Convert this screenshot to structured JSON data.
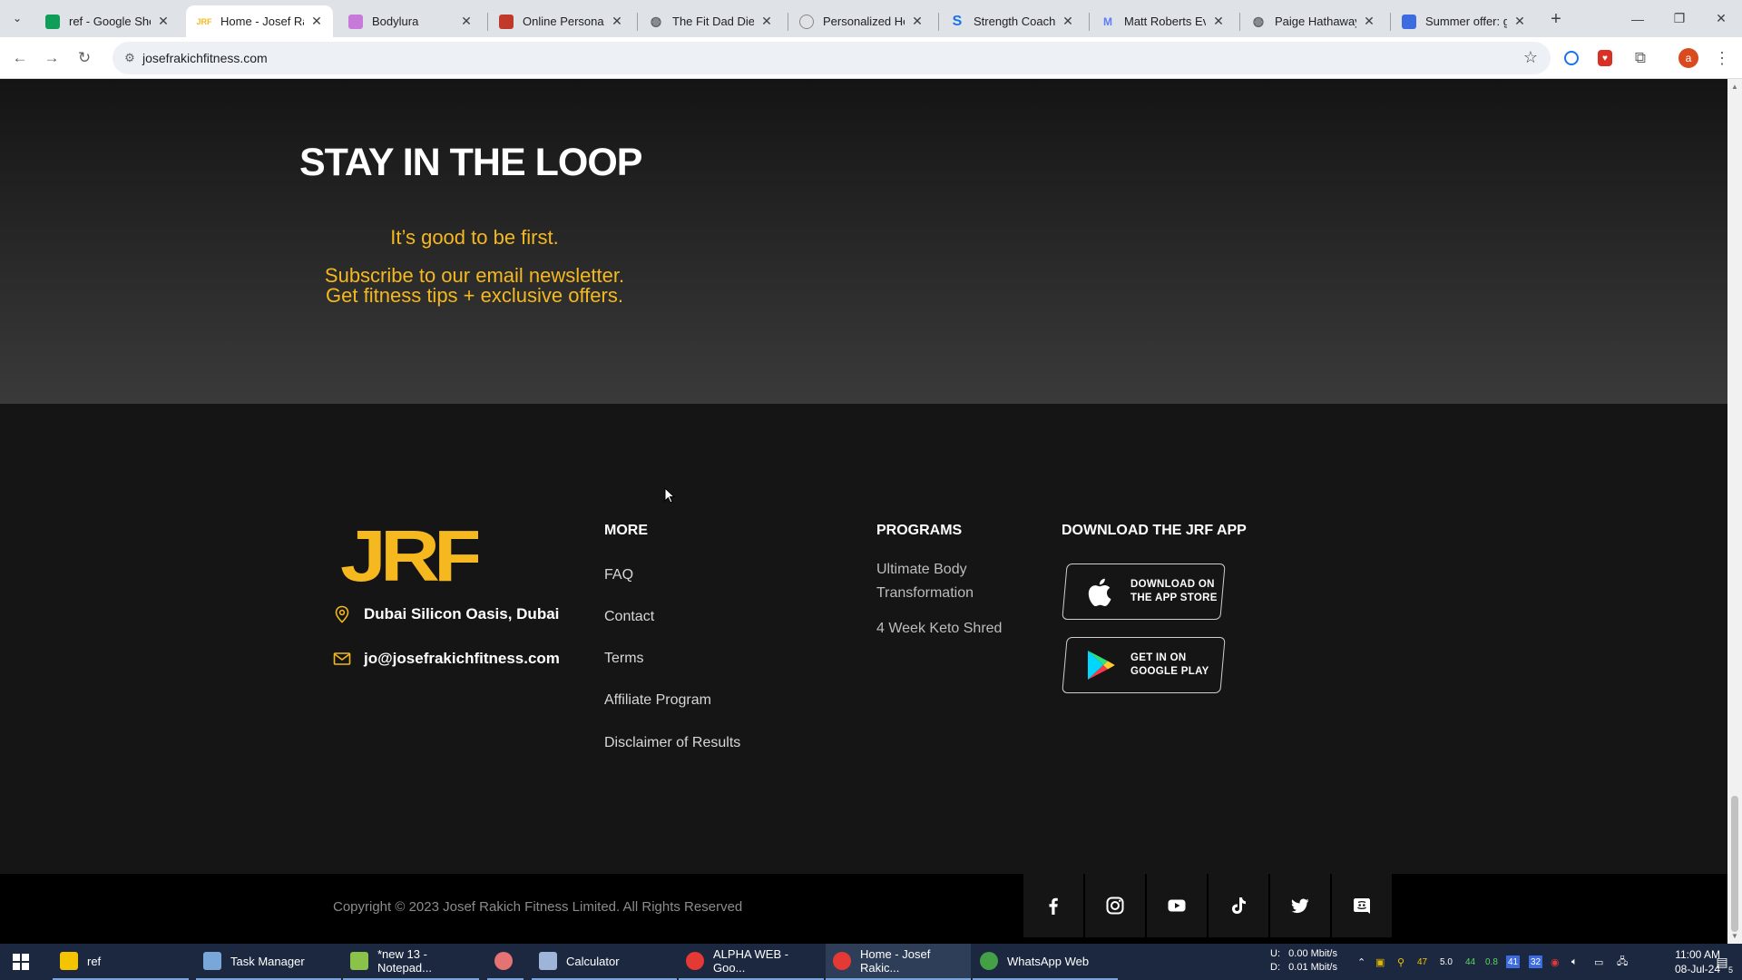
{
  "browser": {
    "tabs": [
      {
        "title": "ref - Google Shee",
        "favicon": "sheets-icon",
        "color": "#0f9d58"
      },
      {
        "title": "Home - Josef Rak",
        "favicon": "jrf-icon",
        "color": "#f5b81e",
        "active": true
      },
      {
        "title": "Bodylura",
        "favicon": "bodylura-icon",
        "color": "#c77ad9"
      },
      {
        "title": "Online Personal Tr",
        "favicon": "trainer-icon",
        "color": "#c0392b"
      },
      {
        "title": "The Fit Dad Diet: /",
        "favicon": "globe-icon",
        "color": "#5f6368"
      },
      {
        "title": "Personalized Heal",
        "favicon": "health-icon",
        "color": "#888888"
      },
      {
        "title": "Strength Coach G",
        "favicon": "strength-icon",
        "color": "#1a73e8"
      },
      {
        "title": "Matt Roberts Evol",
        "favicon": "mr-icon",
        "color": "#5c7cfa"
      },
      {
        "title": "Paige Hathaway",
        "favicon": "globe-icon",
        "color": "#5f6368"
      },
      {
        "title": "Summer offer: get",
        "favicon": "offer-icon",
        "color": "#3d6be0"
      }
    ],
    "new_tab": "+",
    "address": "josefrakichfitness.com",
    "profile_initial": "a"
  },
  "page": {
    "newsletter": {
      "title": "STAY IN THE LOOP",
      "tagline": "It’s good to be first.",
      "line1": "Subscribe to our email newsletter.",
      "line2": "Get fitness tips + exclusive offers."
    },
    "footer": {
      "logo_text": "JRF",
      "address": "Dubai Silicon Oasis, Dubai",
      "email": "jo@josefrakichfitness.com",
      "more": {
        "heading": "MORE",
        "links": [
          "FAQ",
          "Contact",
          "Terms",
          "Affiliate Program",
          "Disclaimer of Results"
        ]
      },
      "programs": {
        "heading": "PROGRAMS",
        "items": [
          "Ultimate Body Transformation",
          "4 Week Keto Shred"
        ]
      },
      "app": {
        "heading": "DOWNLOAD THE JRF APP",
        "appstore_line1": "DOWNLOAD ON",
        "appstore_line2": "THE APP STORE",
        "google_line1": "GET IN ON",
        "google_line2": "GOOGLE PLAY"
      },
      "copyright": "Copyright © 2023 Josef Rakich Fitness Limited. All Rights Reserved",
      "social": [
        "facebook-icon",
        "instagram-icon",
        "youtube-icon",
        "tiktok-icon",
        "twitter-icon",
        "discord-icon"
      ]
    },
    "accent": "#f5b81e"
  },
  "taskbar": {
    "items": [
      {
        "label": "ref",
        "color": "#f5c400"
      },
      {
        "label": "Task Manager",
        "color": "#7aa7d9"
      },
      {
        "label": "*new 13 - Notepad...",
        "color": "#8bc34a"
      },
      {
        "label": "",
        "color": "#e57373"
      },
      {
        "label": "Calculator",
        "color": "#9fb4d9"
      },
      {
        "label": "ALPHA WEB - Goo...",
        "color": "#e53935"
      },
      {
        "label": "Home - Josef Rakic...",
        "color": "#e53935"
      },
      {
        "label": "WhatsApp Web",
        "color": "#43a047"
      }
    ],
    "net_up_label": "U:",
    "net_down_label": "D:",
    "net_up": "0.00 Mbit/s",
    "net_down": "0.01 Mbit/s",
    "tray_nums": [
      "47",
      "5.0",
      "44",
      "0.8",
      "41",
      "32"
    ],
    "time": "11:00 AM",
    "date": "08-Jul-24",
    "notification_count": "5"
  }
}
